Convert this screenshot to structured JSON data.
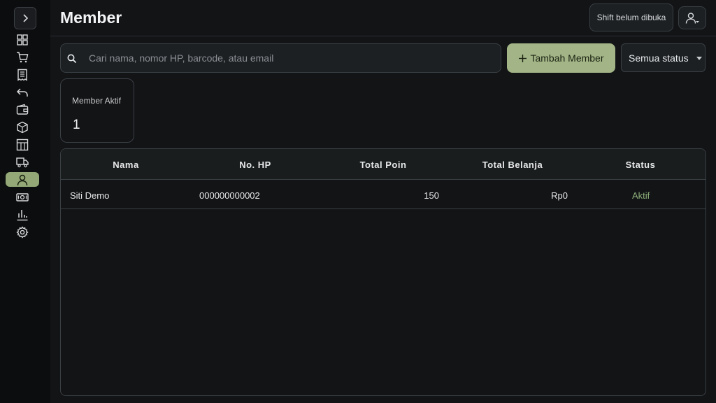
{
  "app": {
    "page_title": "Member"
  },
  "header": {
    "shift_label": "Shift belum dibuka"
  },
  "sidebar": {
    "items": [
      {
        "icon": "dashboard-icon"
      },
      {
        "icon": "cart-icon"
      },
      {
        "icon": "receipt-icon"
      },
      {
        "icon": "return-icon"
      },
      {
        "icon": "wallet-icon"
      },
      {
        "icon": "box-icon"
      },
      {
        "icon": "table-icon"
      },
      {
        "icon": "truck-icon"
      },
      {
        "icon": "user-icon",
        "active": true
      },
      {
        "icon": "cash-icon"
      },
      {
        "icon": "chart-icon"
      },
      {
        "icon": "gear-icon"
      }
    ]
  },
  "search": {
    "placeholder": "Cari nama, nomor HP, barcode, atau email",
    "value": ""
  },
  "toolbar": {
    "add_label": "Tambah Member",
    "status_filter": "Semua status"
  },
  "stats": {
    "active_label": "Member Aktif",
    "active_value": "1"
  },
  "table": {
    "headers": {
      "name": "Nama",
      "phone": "No. HP",
      "points": "Total Poin",
      "spend": "Total Belanja",
      "status": "Status"
    },
    "rows": [
      {
        "name": "Siti Demo",
        "phone": "000000000002",
        "points": "150",
        "spend": "Rp0",
        "status": "Aktif"
      }
    ]
  },
  "colors": {
    "accent": "#a3b587",
    "status_active": "#8fb07a",
    "background": "#121416"
  }
}
